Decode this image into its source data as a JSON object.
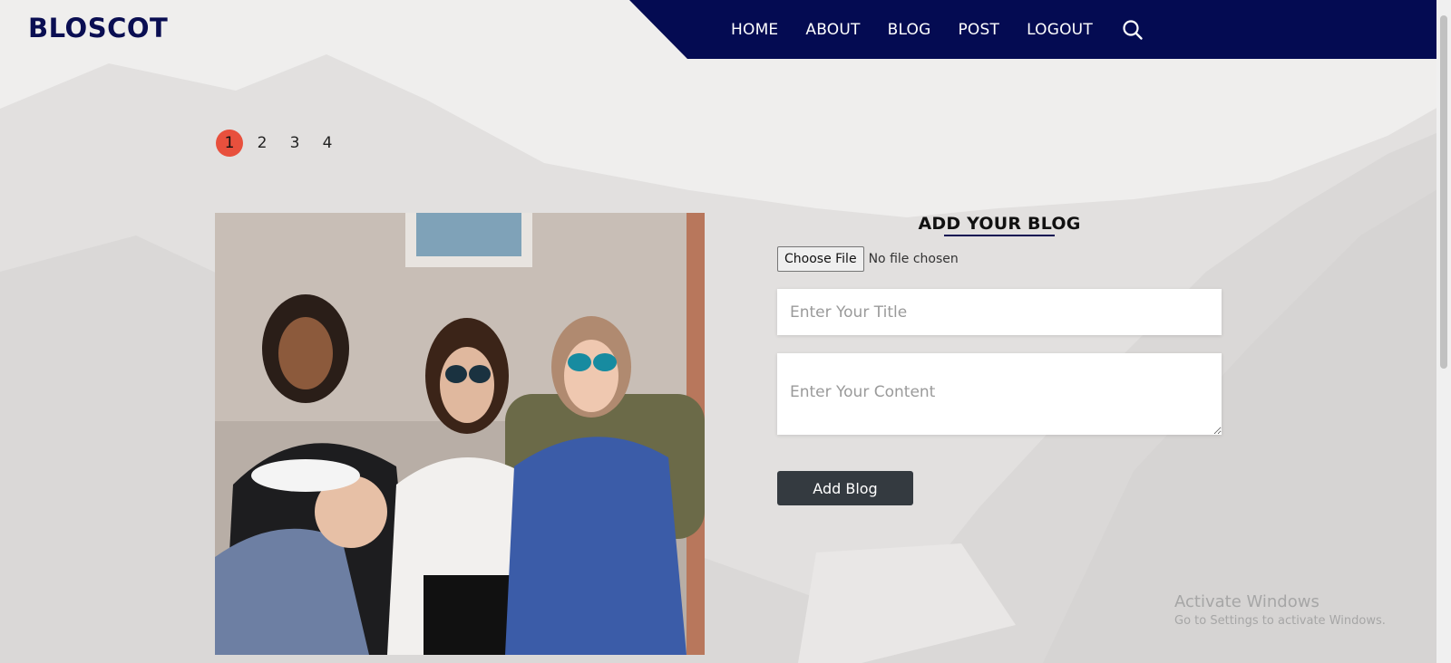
{
  "brand": {
    "name": "BLOSCOT"
  },
  "nav": {
    "items": [
      {
        "label": "HOME"
      },
      {
        "label": "ABOUT"
      },
      {
        "label": "BLOG"
      },
      {
        "label": "POST"
      },
      {
        "label": "LOGOUT"
      }
    ],
    "search_icon": "search-icon"
  },
  "pagination": {
    "pages": [
      "1",
      "2",
      "3",
      "4"
    ],
    "current": "1"
  },
  "form": {
    "title": "ADD YOUR BLOG",
    "file_button": "Choose File",
    "file_status": "No file chosen",
    "title_placeholder": "Enter Your Title",
    "content_placeholder": "Enter Your Content",
    "submit_label": "Add Blog"
  },
  "watermark": {
    "line1": "Activate Windows",
    "line2": "Go to Settings to activate Windows."
  },
  "colors": {
    "navbar": "#040b52",
    "brand": "#0a0e52",
    "active_page": "#e8503d",
    "submit_button": "#343a40"
  }
}
